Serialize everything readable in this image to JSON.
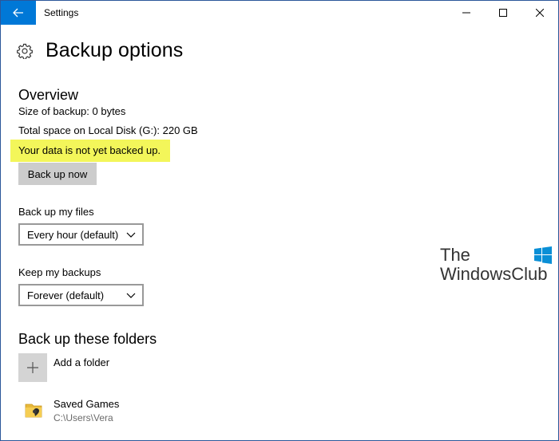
{
  "window": {
    "title": "Settings"
  },
  "header": {
    "title": "Backup options"
  },
  "overview": {
    "title": "Overview",
    "size_of_backup": "Size of backup: 0 bytes",
    "total_space": "Total space on Local Disk (G:): 220 GB",
    "status": "Your data is not yet backed up.",
    "backup_button": "Back up now"
  },
  "backup_frequency": {
    "label": "Back up my files",
    "selected": "Every hour (default)"
  },
  "retention": {
    "label": "Keep my backups",
    "selected": "Forever (default)"
  },
  "folders": {
    "title": "Back up these folders",
    "add_label": "Add a folder",
    "items": [
      {
        "name": "Saved Games",
        "path": "C:\\Users\\Vera"
      }
    ]
  },
  "watermark": {
    "line1": "The",
    "line2": "WindowsClub"
  },
  "colors": {
    "accent": "#0078d7",
    "highlight": "#f3f65a",
    "button": "#cccccc",
    "secondary_text": "#6b6b6b"
  },
  "icons": {
    "back": "arrow-left-icon",
    "minimize": "minimize-icon",
    "maximize": "maximize-icon",
    "close": "close-icon",
    "header": "gear-icon",
    "dropdown": "chevron-down-icon",
    "add": "plus-icon",
    "folder": "folder-icon"
  }
}
